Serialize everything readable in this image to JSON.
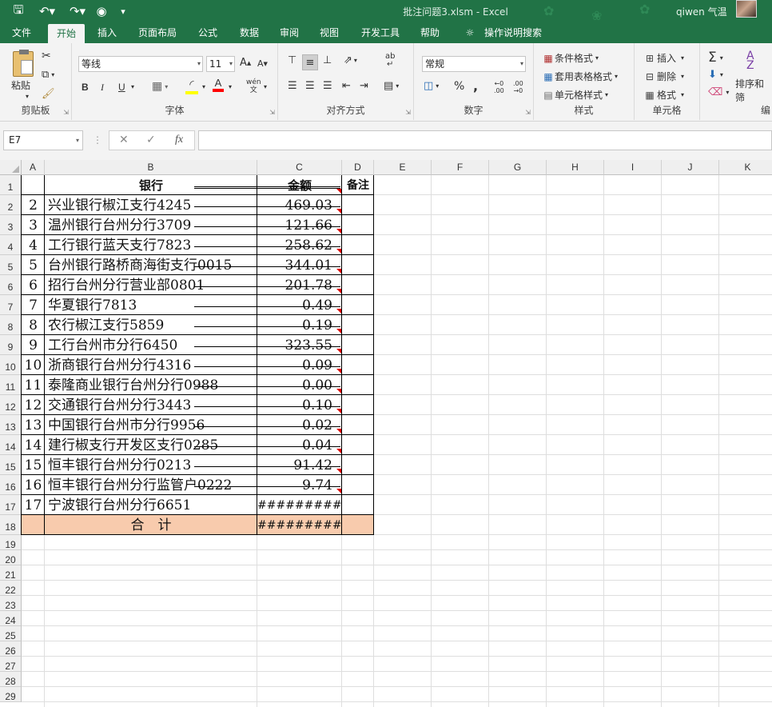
{
  "window": {
    "title": "批注问题3.xlsm  -  Excel",
    "user": "qiwen 气温"
  },
  "tabs": [
    "文件",
    "开始",
    "插入",
    "页面布局",
    "公式",
    "数据",
    "审阅",
    "视图",
    "开发工具",
    "帮助",
    "操作说明搜索"
  ],
  "active_tab": "开始",
  "ribbon": {
    "clipboard": {
      "label": "剪贴板",
      "paste": "粘贴"
    },
    "font": {
      "label": "字体",
      "name": "等线",
      "size": "11",
      "bold": "B",
      "italic": "I",
      "underline": "U",
      "phonetic": "wén"
    },
    "alignment": {
      "label": "对齐方式"
    },
    "number": {
      "label": "数字",
      "format": "常规",
      "percent": "%",
      "comma": ","
    },
    "styles": {
      "label": "样式",
      "conditional": "条件格式",
      "table": "套用表格格式",
      "cell": "单元格样式"
    },
    "cells": {
      "label": "单元格",
      "insert": "插入",
      "delete": "删除",
      "format": "格式"
    },
    "editing": {
      "label": "编",
      "sort": "排序和筛"
    }
  },
  "formula_bar": {
    "name_box": "E7",
    "fx": "fx",
    "cancel": "✕",
    "enter": "✓",
    "value": ""
  },
  "columns": [
    "A",
    "B",
    "C",
    "D",
    "E",
    "F",
    "G",
    "H",
    "I",
    "J",
    "K"
  ],
  "rows": [
    "1",
    "2",
    "3",
    "4",
    "5",
    "6",
    "7",
    "8",
    "9",
    "10",
    "11",
    "12",
    "13",
    "14",
    "15",
    "16",
    "17",
    "18",
    "19",
    "20",
    "21",
    "22",
    "23",
    "24",
    "25",
    "26",
    "27",
    "28",
    "29"
  ],
  "table": {
    "header": {
      "bank": "银行",
      "amount": "金额",
      "note": "备注"
    },
    "rows": [
      {
        "no": "2",
        "bank": "兴业银行椒江支行4245",
        "amount": "469.03"
      },
      {
        "no": "3",
        "bank": "温州银行台州分行3709",
        "amount": "121.66"
      },
      {
        "no": "4",
        "bank": "工行银行蓝天支行7823",
        "amount": "258.62"
      },
      {
        "no": "5",
        "bank": "台州银行路桥商海街支行0015",
        "amount": "344.01"
      },
      {
        "no": "6",
        "bank": "招行台州分行营业部0801",
        "amount": "201.78"
      },
      {
        "no": "7",
        "bank": "华夏银行7813",
        "amount": "0.49"
      },
      {
        "no": "8",
        "bank": "农行椒江支行5859",
        "amount": "0.19"
      },
      {
        "no": "9",
        "bank": "工行台州市分行6450",
        "amount": "323.55"
      },
      {
        "no": "10",
        "bank": "浙商银行台州分行4316",
        "amount": "0.09"
      },
      {
        "no": "11",
        "bank": "泰隆商业银行台州分行0988",
        "amount": "0.00"
      },
      {
        "no": "12",
        "bank": "交通银行台州分行3443",
        "amount": "0.10"
      },
      {
        "no": "13",
        "bank": "中国银行台州市分行9956",
        "amount": "0.02"
      },
      {
        "no": "14",
        "bank": "建行椒支行开发区支行0285",
        "amount": "0.04"
      },
      {
        "no": "15",
        "bank": "恒丰银行台州分行0213",
        "amount": "91.42"
      },
      {
        "no": "16",
        "bank": "恒丰银行台州分行监管户0222",
        "amount": "9.74"
      },
      {
        "no": "17",
        "bank": "宁波银行台州分行6651",
        "amount": "#########"
      }
    ],
    "total": {
      "label": "合　计",
      "amount": "#########"
    }
  },
  "colors": {
    "excel_green": "#217346",
    "total_fill": "#f8cbad",
    "comment_marker": "#e00000"
  }
}
